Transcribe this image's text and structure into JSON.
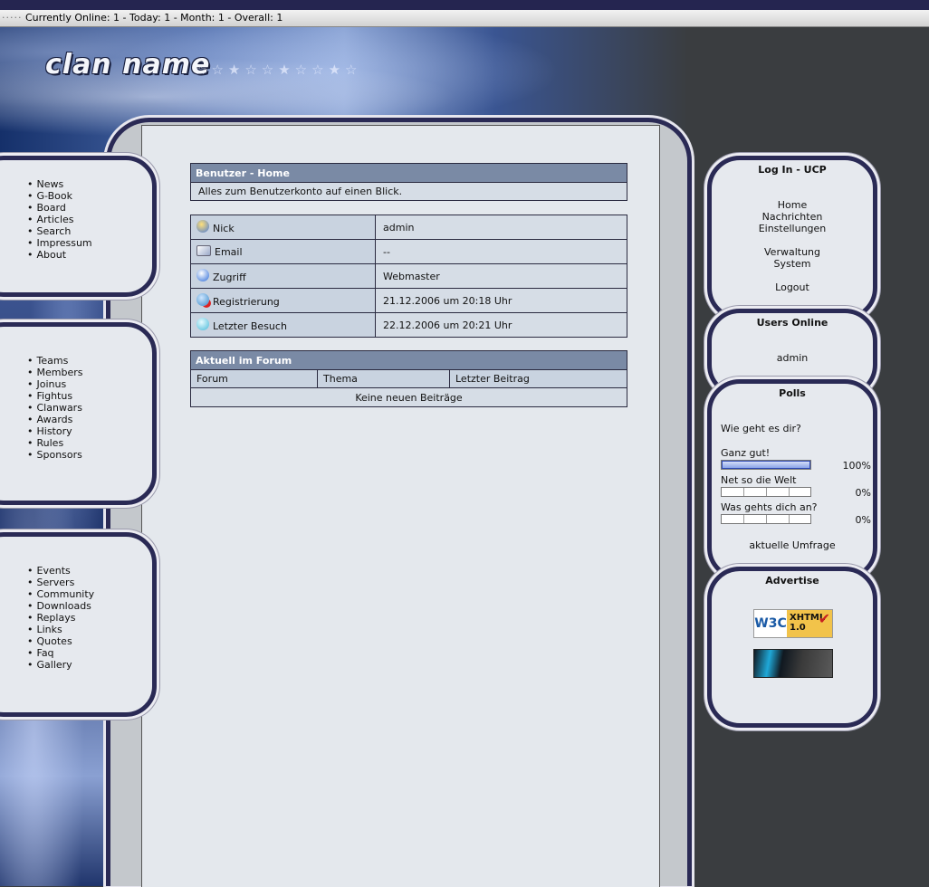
{
  "topbar": {
    "dots": "·····",
    "status": "Currently Online: 1 - Today: 1 - Month: 1 - Overall: 1"
  },
  "logo": {
    "text": "clan name"
  },
  "nav_groups": [
    {
      "items": [
        "News",
        "G-Book",
        "Board",
        "Articles",
        "Search",
        "Impressum",
        "About"
      ]
    },
    {
      "items": [
        "Teams",
        "Members",
        "Joinus",
        "Fightus",
        "Clanwars",
        "Awards",
        "History",
        "Rules",
        "Sponsors"
      ]
    },
    {
      "items": [
        "Events",
        "Servers",
        "Community",
        "Downloads",
        "Replays",
        "Links",
        "Quotes",
        "Faq",
        "Gallery"
      ]
    }
  ],
  "user_home": {
    "title": "Benutzer - Home",
    "subtitle": "Alles zum Benutzerkonto auf einen Blick."
  },
  "profile": [
    {
      "icon": "user-icon",
      "label": "Nick",
      "value": "admin"
    },
    {
      "icon": "email-icon",
      "label": "Email",
      "value": "--"
    },
    {
      "icon": "access-icon",
      "label": "Zugriff",
      "value": "Webmaster"
    },
    {
      "icon": "register-icon",
      "label": "Registrierung",
      "value": "21.12.2006 um 20:18 Uhr"
    },
    {
      "icon": "last-visit-icon",
      "label": "Letzter Besuch",
      "value": "22.12.2006 um 20:21 Uhr"
    }
  ],
  "forum": {
    "title": "Aktuell im Forum",
    "columns": [
      "Forum",
      "Thema",
      "Letzter Beitrag"
    ],
    "empty": "Keine neuen Beiträge"
  },
  "login_box": {
    "title": "Log In - UCP",
    "links": [
      "Home",
      "Nachrichten",
      "Einstellungen",
      "Verwaltung",
      "System",
      "Logout"
    ]
  },
  "users_online": {
    "title": "Users Online",
    "users": [
      "admin"
    ]
  },
  "polls": {
    "title": "Polls",
    "question": "Wie geht es dir?",
    "answers": [
      {
        "label": "Ganz gut!",
        "percent": "100%",
        "fraction": 1.0
      },
      {
        "label": "Net so die Welt",
        "percent": "0%",
        "fraction": 0
      },
      {
        "label": "Was gehts dich an?",
        "percent": "0%",
        "fraction": 0
      }
    ],
    "link": "aktuelle Umfrage"
  },
  "advertise": {
    "title": "Advertise",
    "badge_left": "W3C",
    "badge_right_1": "XHTML",
    "badge_right_2": "1.0"
  },
  "colors": {
    "frame": "#2a2a55",
    "header": "#7a8aa5",
    "content": "#e4e8ed",
    "page_bg": "#3a3d40"
  }
}
